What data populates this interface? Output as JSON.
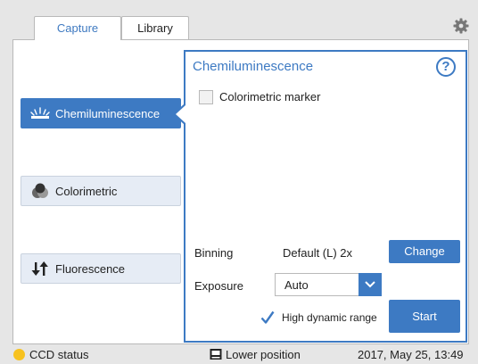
{
  "tabs": [
    {
      "label": "Capture",
      "active": true
    },
    {
      "label": "Library",
      "active": false
    }
  ],
  "icons": {
    "settings": "gear-icon",
    "help": "question-icon",
    "chemi": "chemiluminescence-icon",
    "colorimetric": "colorimetric-icon",
    "fluorescence": "fluorescence-arrows-icon",
    "dropdown": "chevron-down-icon",
    "check": "checkmark-icon",
    "position": "tray-icon"
  },
  "modes": {
    "chemi_label": "Chemiluminescence",
    "colorimetric_label": "Colorimetric",
    "fluorescence_label": "Fluorescence",
    "selected": "Chemiluminescence"
  },
  "detail": {
    "title": "Chemiluminescence",
    "help_symbol": "?",
    "colorimetric_marker_label": "Colorimetric marker",
    "colorimetric_marker_checked": false,
    "binning_label": "Binning",
    "binning_value": "Default (L) 2x",
    "change_button": "Change",
    "exposure_label": "Exposure",
    "exposure_value": "Auto",
    "hdr_label": "High dynamic range",
    "hdr_checked": true,
    "start_button": "Start"
  },
  "status": {
    "ccd_label": "CCD status",
    "position_label": "Lower position",
    "datetime": "2017, May 25, 13:49"
  },
  "colors": {
    "accent": "#3d7ac3",
    "ccd_status": "#f7c21f",
    "background": "#e6e6e6"
  }
}
